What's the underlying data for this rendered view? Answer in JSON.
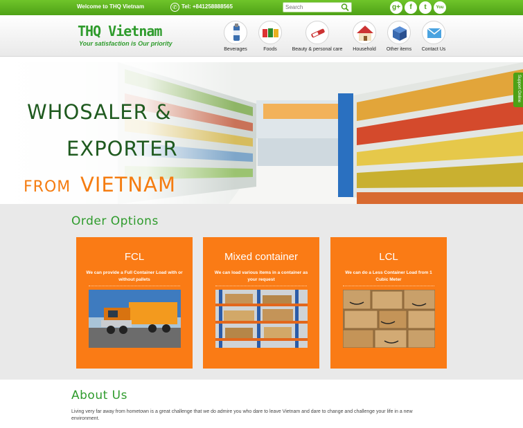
{
  "topbar": {
    "welcome": "Welcome to THQ Vietnam",
    "phone": "Tel: +841258888565",
    "search_placeholder": "Search",
    "social_icons": [
      "google-plus-icon",
      "facebook-icon",
      "twitter-icon",
      "youtube-icon"
    ],
    "social_glyphs": [
      "g+",
      "f",
      "t",
      "You"
    ]
  },
  "header": {
    "logo": "THQ Vietnam",
    "tagline": "Your satisfaction is Our priority",
    "nav": [
      {
        "label": "Beverages",
        "icon": "bottle-icon"
      },
      {
        "label": "Foods",
        "icon": "cans-icon"
      },
      {
        "label": "Beauty & personal care",
        "icon": "cosmetics-icon"
      },
      {
        "label": "Household",
        "icon": "house-icon"
      },
      {
        "label": "Other items",
        "icon": "boxes-icon"
      },
      {
        "label": "Contact Us",
        "icon": "envelope-icon"
      }
    ]
  },
  "hero": {
    "line1": "WHOSALER &",
    "line2": "EXPORTER",
    "line3_from": "FROM",
    "line3_country": "VIETNAM",
    "support": "Support Online"
  },
  "order": {
    "title": "Order Options",
    "cards": [
      {
        "title": "FCL",
        "desc": "We can provide a Full Container Load with or without pallets",
        "image": "truck-image"
      },
      {
        "title": "Mixed container",
        "desc": "We can load various items in a container as your request",
        "image": "warehouse-image"
      },
      {
        "title": "LCL",
        "desc": "We can do a Less Container Load from 1 Cubic Meter",
        "image": "boxes-image"
      }
    ]
  },
  "about": {
    "title": "About Us",
    "text": "Living very far away from  hometown is a great challenge that we do admire you who dare to leave Vietnam and dare to change and challenge your life in a new environment."
  },
  "colors": {
    "green": "#4ea116",
    "brand_green": "#2e9b2c",
    "orange": "#fa7b15",
    "hero_dark_green": "#1f5a1f"
  }
}
